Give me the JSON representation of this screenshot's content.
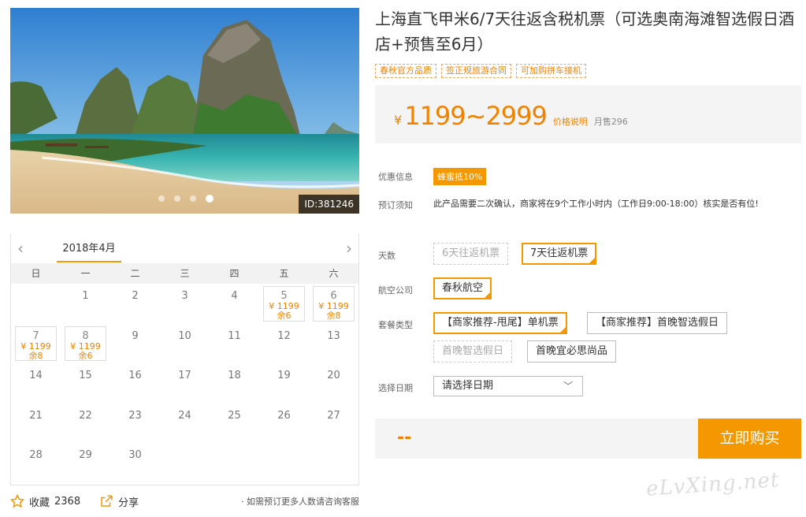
{
  "gallery": {
    "id_tag": "ID:381246",
    "dots": 4,
    "active_dot": 3
  },
  "calendar": {
    "month": "2018年4月",
    "weekdays": [
      "日",
      "一",
      "二",
      "三",
      "四",
      "五",
      "六"
    ],
    "days": [
      {
        "d": "",
        "p": "",
        "s": ""
      },
      {
        "d": "1",
        "p": "",
        "s": ""
      },
      {
        "d": "2",
        "p": "",
        "s": ""
      },
      {
        "d": "3",
        "p": "",
        "s": ""
      },
      {
        "d": "4",
        "p": "",
        "s": ""
      },
      {
        "d": "5",
        "p": "¥ 1199",
        "s": "余6"
      },
      {
        "d": "6",
        "p": "¥ 1199",
        "s": "余8"
      },
      {
        "d": "7",
        "p": "¥ 1199",
        "s": "余8"
      },
      {
        "d": "8",
        "p": "¥ 1199",
        "s": "余6"
      },
      {
        "d": "9",
        "p": "",
        "s": ""
      },
      {
        "d": "10",
        "p": "",
        "s": ""
      },
      {
        "d": "11",
        "p": "",
        "s": ""
      },
      {
        "d": "12",
        "p": "",
        "s": ""
      },
      {
        "d": "13",
        "p": "",
        "s": ""
      },
      {
        "d": "14",
        "p": "",
        "s": ""
      },
      {
        "d": "15",
        "p": "",
        "s": ""
      },
      {
        "d": "16",
        "p": "",
        "s": ""
      },
      {
        "d": "17",
        "p": "",
        "s": ""
      },
      {
        "d": "18",
        "p": "",
        "s": ""
      },
      {
        "d": "19",
        "p": "",
        "s": ""
      },
      {
        "d": "20",
        "p": "",
        "s": ""
      },
      {
        "d": "21",
        "p": "",
        "s": ""
      },
      {
        "d": "22",
        "p": "",
        "s": ""
      },
      {
        "d": "23",
        "p": "",
        "s": ""
      },
      {
        "d": "24",
        "p": "",
        "s": ""
      },
      {
        "d": "25",
        "p": "",
        "s": ""
      },
      {
        "d": "26",
        "p": "",
        "s": ""
      },
      {
        "d": "27",
        "p": "",
        "s": ""
      },
      {
        "d": "28",
        "p": "",
        "s": ""
      },
      {
        "d": "29",
        "p": "",
        "s": ""
      },
      {
        "d": "30",
        "p": "",
        "s": ""
      }
    ]
  },
  "footer": {
    "fav_label": "收藏",
    "fav_count": "2368",
    "share_label": "分享",
    "note": "如需预订更多人数请咨询客服"
  },
  "product": {
    "title": "上海直飞甲米6/7天往返含税机票（可选奥南海滩智选假日酒店+预售至6月）",
    "tags": [
      "春秋官方品质",
      "签正规旅游合同",
      "可加购拼车接机"
    ],
    "currency": "¥",
    "price_range": "1199~2999",
    "price_note": "价格说明",
    "sales": "月售296"
  },
  "promo": {
    "label": "优惠信息",
    "badge": "蜂蜜抵10%"
  },
  "notice": {
    "label": "预订须知",
    "text": "此产品需要二次确认，商家将在9个工作小时内（工作日9:00-18:00）核实是否有位!"
  },
  "options": {
    "days_label": "天数",
    "days": [
      "6天往返机票",
      "7天往返机票"
    ],
    "airline_label": "航空公司",
    "airline": "春秋航空",
    "package_label": "套餐类型",
    "packages": [
      "【商家推荐-甩尾】单机票",
      "【商家推荐】首晚智选假日",
      "首晚智选假日",
      "首晚宜必思尚品"
    ],
    "date_label": "选择日期",
    "date_placeholder": "请选择日期"
  },
  "buy": {
    "total": "--",
    "button": "立即购买"
  },
  "watermark": "eLvXing.net",
  "colors": {
    "accent": "#f39800",
    "price": "#f08200"
  }
}
